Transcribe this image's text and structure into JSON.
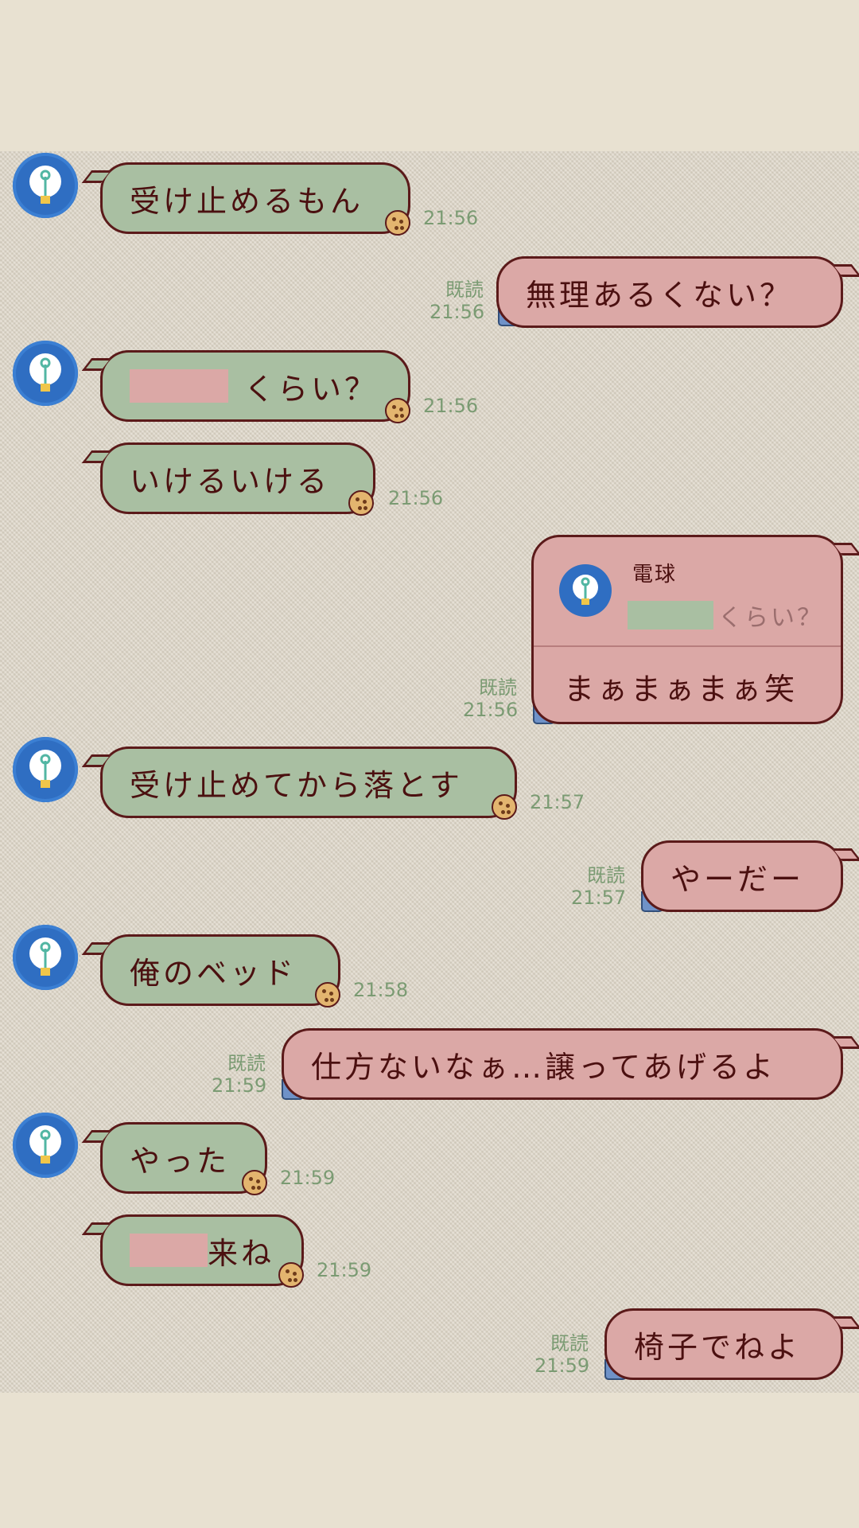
{
  "messages": [
    {
      "text": "受け止めるもん",
      "time": "21:56"
    },
    {
      "text": "無理あるくない？",
      "read": "既読",
      "time": "21:56"
    },
    {
      "text": "くらい？",
      "time": "21:56"
    },
    {
      "text": "いけるいける",
      "time": "21:56"
    },
    {
      "reply_name": "電球",
      "reply_quote": "くらい？",
      "text": "まぁまぁまぁ笑",
      "read": "既読",
      "time": "21:56"
    },
    {
      "text": "受け止めてから落とす",
      "time": "21:57"
    },
    {
      "text": "やーだー",
      "read": "既読",
      "time": "21:57"
    },
    {
      "text": "俺のベッド",
      "time": "21:58"
    },
    {
      "text": "仕方ないなぁ…譲ってあげるよ",
      "read": "既読",
      "time": "21:59"
    },
    {
      "text": "やった",
      "time": "21:59"
    },
    {
      "text": "来ね",
      "time": "21:59"
    },
    {
      "text": "椅子でねよ",
      "read": "既読",
      "time": "21:59"
    }
  ],
  "icons": {
    "avatar": "lightbulb-avatar-icon",
    "incoming_sticker": "cookie-icon",
    "outgoing_sticker": "mug-icon"
  },
  "colors": {
    "incoming_bubble": "#a9bfa2",
    "outgoing_bubble": "#dba8a6",
    "bubble_border": "#5b1a1a",
    "timestamp": "#7b9b73",
    "avatar": "#2f6ec2"
  }
}
